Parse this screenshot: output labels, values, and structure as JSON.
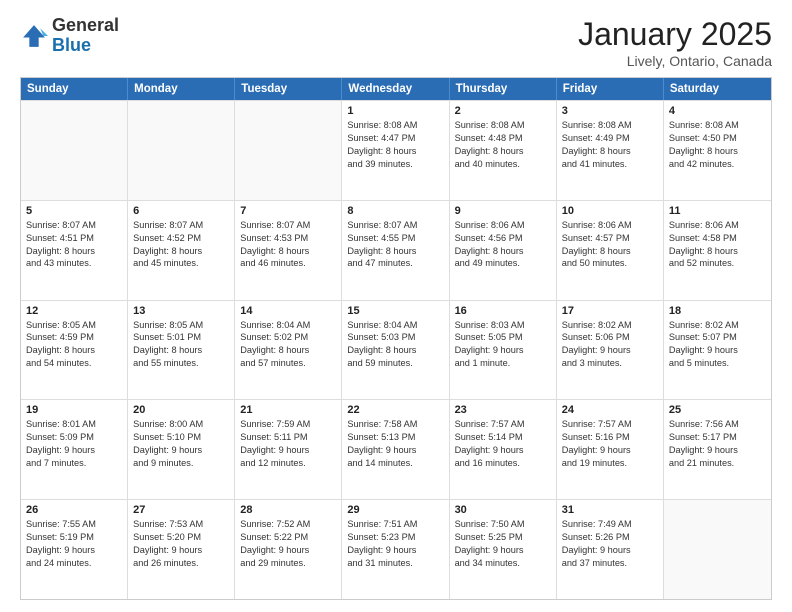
{
  "logo": {
    "general": "General",
    "blue": "Blue"
  },
  "title": {
    "month": "January 2025",
    "location": "Lively, Ontario, Canada"
  },
  "header_days": [
    "Sunday",
    "Monday",
    "Tuesday",
    "Wednesday",
    "Thursday",
    "Friday",
    "Saturday"
  ],
  "weeks": [
    [
      {
        "day": "",
        "sunrise": "",
        "sunset": "",
        "daylight": ""
      },
      {
        "day": "",
        "sunrise": "",
        "sunset": "",
        "daylight": ""
      },
      {
        "day": "",
        "sunrise": "",
        "sunset": "",
        "daylight": ""
      },
      {
        "day": "1",
        "sunrise": "Sunrise: 8:08 AM",
        "sunset": "Sunset: 4:47 PM",
        "daylight": "Daylight: 8 hours and 39 minutes."
      },
      {
        "day": "2",
        "sunrise": "Sunrise: 8:08 AM",
        "sunset": "Sunset: 4:48 PM",
        "daylight": "Daylight: 8 hours and 40 minutes."
      },
      {
        "day": "3",
        "sunrise": "Sunrise: 8:08 AM",
        "sunset": "Sunset: 4:49 PM",
        "daylight": "Daylight: 8 hours and 41 minutes."
      },
      {
        "day": "4",
        "sunrise": "Sunrise: 8:08 AM",
        "sunset": "Sunset: 4:50 PM",
        "daylight": "Daylight: 8 hours and 42 minutes."
      }
    ],
    [
      {
        "day": "5",
        "sunrise": "Sunrise: 8:07 AM",
        "sunset": "Sunset: 4:51 PM",
        "daylight": "Daylight: 8 hours and 43 minutes."
      },
      {
        "day": "6",
        "sunrise": "Sunrise: 8:07 AM",
        "sunset": "Sunset: 4:52 PM",
        "daylight": "Daylight: 8 hours and 45 minutes."
      },
      {
        "day": "7",
        "sunrise": "Sunrise: 8:07 AM",
        "sunset": "Sunset: 4:53 PM",
        "daylight": "Daylight: 8 hours and 46 minutes."
      },
      {
        "day": "8",
        "sunrise": "Sunrise: 8:07 AM",
        "sunset": "Sunset: 4:55 PM",
        "daylight": "Daylight: 8 hours and 47 minutes."
      },
      {
        "day": "9",
        "sunrise": "Sunrise: 8:06 AM",
        "sunset": "Sunset: 4:56 PM",
        "daylight": "Daylight: 8 hours and 49 minutes."
      },
      {
        "day": "10",
        "sunrise": "Sunrise: 8:06 AM",
        "sunset": "Sunset: 4:57 PM",
        "daylight": "Daylight: 8 hours and 50 minutes."
      },
      {
        "day": "11",
        "sunrise": "Sunrise: 8:06 AM",
        "sunset": "Sunset: 4:58 PM",
        "daylight": "Daylight: 8 hours and 52 minutes."
      }
    ],
    [
      {
        "day": "12",
        "sunrise": "Sunrise: 8:05 AM",
        "sunset": "Sunset: 4:59 PM",
        "daylight": "Daylight: 8 hours and 54 minutes."
      },
      {
        "day": "13",
        "sunrise": "Sunrise: 8:05 AM",
        "sunset": "Sunset: 5:01 PM",
        "daylight": "Daylight: 8 hours and 55 minutes."
      },
      {
        "day": "14",
        "sunrise": "Sunrise: 8:04 AM",
        "sunset": "Sunset: 5:02 PM",
        "daylight": "Daylight: 8 hours and 57 minutes."
      },
      {
        "day": "15",
        "sunrise": "Sunrise: 8:04 AM",
        "sunset": "Sunset: 5:03 PM",
        "daylight": "Daylight: 8 hours and 59 minutes."
      },
      {
        "day": "16",
        "sunrise": "Sunrise: 8:03 AM",
        "sunset": "Sunset: 5:05 PM",
        "daylight": "Daylight: 9 hours and 1 minute."
      },
      {
        "day": "17",
        "sunrise": "Sunrise: 8:02 AM",
        "sunset": "Sunset: 5:06 PM",
        "daylight": "Daylight: 9 hours and 3 minutes."
      },
      {
        "day": "18",
        "sunrise": "Sunrise: 8:02 AM",
        "sunset": "Sunset: 5:07 PM",
        "daylight": "Daylight: 9 hours and 5 minutes."
      }
    ],
    [
      {
        "day": "19",
        "sunrise": "Sunrise: 8:01 AM",
        "sunset": "Sunset: 5:09 PM",
        "daylight": "Daylight: 9 hours and 7 minutes."
      },
      {
        "day": "20",
        "sunrise": "Sunrise: 8:00 AM",
        "sunset": "Sunset: 5:10 PM",
        "daylight": "Daylight: 9 hours and 9 minutes."
      },
      {
        "day": "21",
        "sunrise": "Sunrise: 7:59 AM",
        "sunset": "Sunset: 5:11 PM",
        "daylight": "Daylight: 9 hours and 12 minutes."
      },
      {
        "day": "22",
        "sunrise": "Sunrise: 7:58 AM",
        "sunset": "Sunset: 5:13 PM",
        "daylight": "Daylight: 9 hours and 14 minutes."
      },
      {
        "day": "23",
        "sunrise": "Sunrise: 7:57 AM",
        "sunset": "Sunset: 5:14 PM",
        "daylight": "Daylight: 9 hours and 16 minutes."
      },
      {
        "day": "24",
        "sunrise": "Sunrise: 7:57 AM",
        "sunset": "Sunset: 5:16 PM",
        "daylight": "Daylight: 9 hours and 19 minutes."
      },
      {
        "day": "25",
        "sunrise": "Sunrise: 7:56 AM",
        "sunset": "Sunset: 5:17 PM",
        "daylight": "Daylight: 9 hours and 21 minutes."
      }
    ],
    [
      {
        "day": "26",
        "sunrise": "Sunrise: 7:55 AM",
        "sunset": "Sunset: 5:19 PM",
        "daylight": "Daylight: 9 hours and 24 minutes."
      },
      {
        "day": "27",
        "sunrise": "Sunrise: 7:53 AM",
        "sunset": "Sunset: 5:20 PM",
        "daylight": "Daylight: 9 hours and 26 minutes."
      },
      {
        "day": "28",
        "sunrise": "Sunrise: 7:52 AM",
        "sunset": "Sunset: 5:22 PM",
        "daylight": "Daylight: 9 hours and 29 minutes."
      },
      {
        "day": "29",
        "sunrise": "Sunrise: 7:51 AM",
        "sunset": "Sunset: 5:23 PM",
        "daylight": "Daylight: 9 hours and 31 minutes."
      },
      {
        "day": "30",
        "sunrise": "Sunrise: 7:50 AM",
        "sunset": "Sunset: 5:25 PM",
        "daylight": "Daylight: 9 hours and 34 minutes."
      },
      {
        "day": "31",
        "sunrise": "Sunrise: 7:49 AM",
        "sunset": "Sunset: 5:26 PM",
        "daylight": "Daylight: 9 hours and 37 minutes."
      },
      {
        "day": "",
        "sunrise": "",
        "sunset": "",
        "daylight": ""
      }
    ]
  ]
}
